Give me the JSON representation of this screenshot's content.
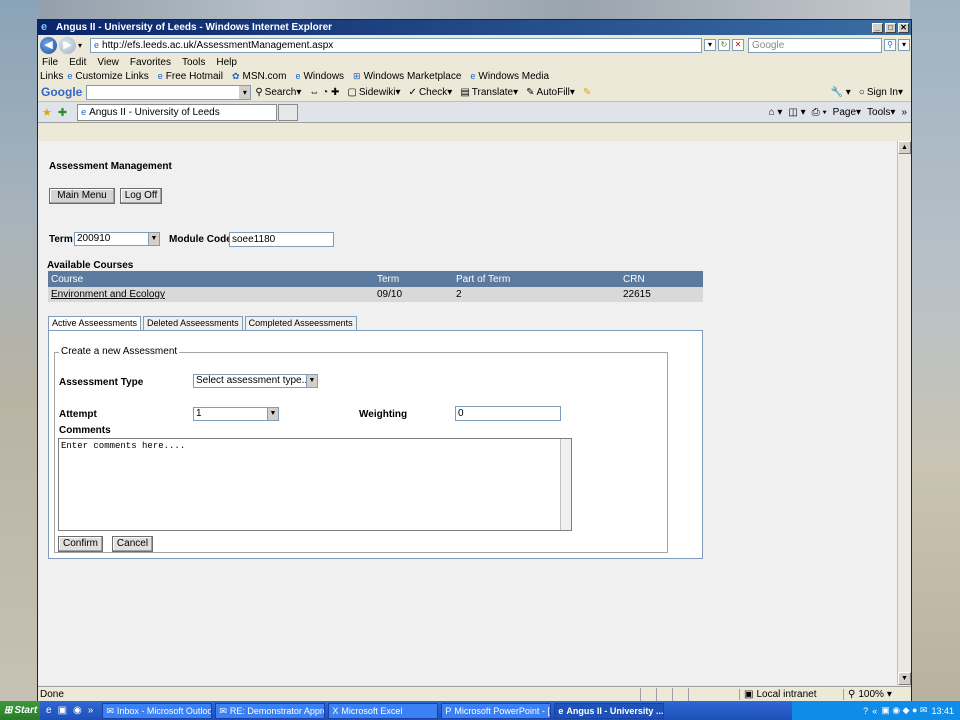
{
  "window": {
    "title": "Angus II - University of Leeds - Windows Internet Explorer",
    "url": "http://efs.leeds.ac.uk/AssessmentManagement.aspx",
    "search_placeholder": "Google"
  },
  "menu": [
    "File",
    "Edit",
    "View",
    "Favorites",
    "Tools",
    "Help"
  ],
  "links": {
    "label": "Links",
    "items": [
      "Customize Links",
      "Free Hotmail",
      "MSN.com",
      "Windows",
      "Windows Marketplace",
      "Windows Media"
    ]
  },
  "google_toolbar": {
    "logo": "Google",
    "items": [
      "Search",
      "Sidewiki",
      "Check",
      "Translate",
      "AutoFill"
    ],
    "sign_in": "Sign In"
  },
  "tab": {
    "label": "Angus II - University of Leeds"
  },
  "commands": [
    "Page",
    "Tools"
  ],
  "page": {
    "title": "Assessment Management",
    "main_menu": "Main Menu",
    "log_off": "Log Off",
    "term_label": "Term",
    "term_value": "200910",
    "module_code_label": "Module Code",
    "module_code_value": "soee1180",
    "available_courses": "Available Courses",
    "table": {
      "headers": [
        "Course",
        "Term",
        "Part of Term",
        "CRN"
      ],
      "rows": [
        [
          "Environment and Ecology",
          "09/10",
          "2",
          "22615"
        ]
      ]
    },
    "tabs": [
      "Active Asseessments",
      "Deleted Asseessments",
      "Completed Asseessments"
    ],
    "form": {
      "legend": "Create a new Assessment",
      "type_label": "Assessment Type",
      "type_value": "Select assessment type....",
      "attempt_label": "Attempt",
      "attempt_value": "1",
      "weighting_label": "Weighting",
      "weighting_value": "0",
      "comments_label": "Comments",
      "comments_placeholder": "Enter comments here....",
      "confirm": "Confirm",
      "cancel": "Cancel"
    }
  },
  "status": {
    "text": "Done",
    "zone": "Local intranet",
    "zoom": "100%"
  },
  "taskbar": {
    "start": "Start",
    "tasks": [
      "Inbox - Microsoft Outlook",
      "RE: Demonstrator Appro...",
      "Microsoft Excel",
      "Microsoft PowerPoint - [...",
      "Angus II - University ..."
    ],
    "clock": "13:41"
  }
}
